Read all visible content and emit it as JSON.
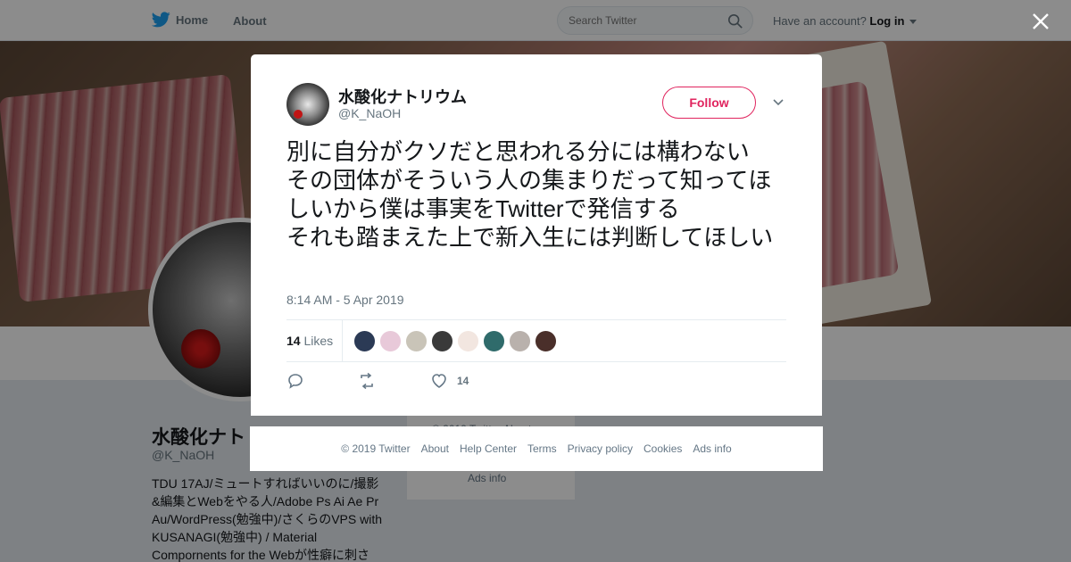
{
  "nav": {
    "home_label": "Home",
    "about_label": "About",
    "search_placeholder": "Search Twitter",
    "account_prompt": "Have an account?",
    "login_label": "Log in"
  },
  "profile": {
    "name": "水酸化ナト",
    "handle": "@K_NaOH",
    "bio": "TDU 17AJ/ミュートすればいいのに/撮影&編集とWebをやる人/Adobe Ps Ai Ae Pr Au/WordPress(勉強中)/さくらのVPS with KUSANAGI(勉強中) / Material Compornents for the Webが性癖に刺さ",
    "side_copyright": "© 2019 Twitter About",
    "side_ads": "Ads info"
  },
  "tweet": {
    "display_name": "水酸化ナトリウム",
    "handle": "@K_NaOH",
    "follow_label": "Follow",
    "text": "別に自分がクソだと思われる分には構わない\nその団体がそういう人の集まりだって知ってほしいから僕は事実をTwitterで発信する\nそれも踏まえた上で新入生には判断してほしい",
    "timestamp": "8:14 AM - 5 Apr 2019",
    "likes_number": "14",
    "likes_label": "Likes",
    "like_action_count": "14",
    "liker_avatars": [
      {
        "color": "#2b3a55"
      },
      {
        "color": "#e8c9d9"
      },
      {
        "color": "#c9c4b8"
      },
      {
        "color": "#3a3a3a"
      },
      {
        "color": "#f2e6e0"
      },
      {
        "color": "#2f6b6b"
      },
      {
        "color": "#b9b1ac"
      },
      {
        "color": "#4a2f2a"
      }
    ]
  },
  "footer": {
    "links": [
      "© 2019 Twitter",
      "About",
      "Help Center",
      "Terms",
      "Privacy policy",
      "Cookies",
      "Ads info"
    ]
  },
  "colors": {
    "accent": "#e0245e",
    "twitter_blue": "#1da1f2"
  }
}
